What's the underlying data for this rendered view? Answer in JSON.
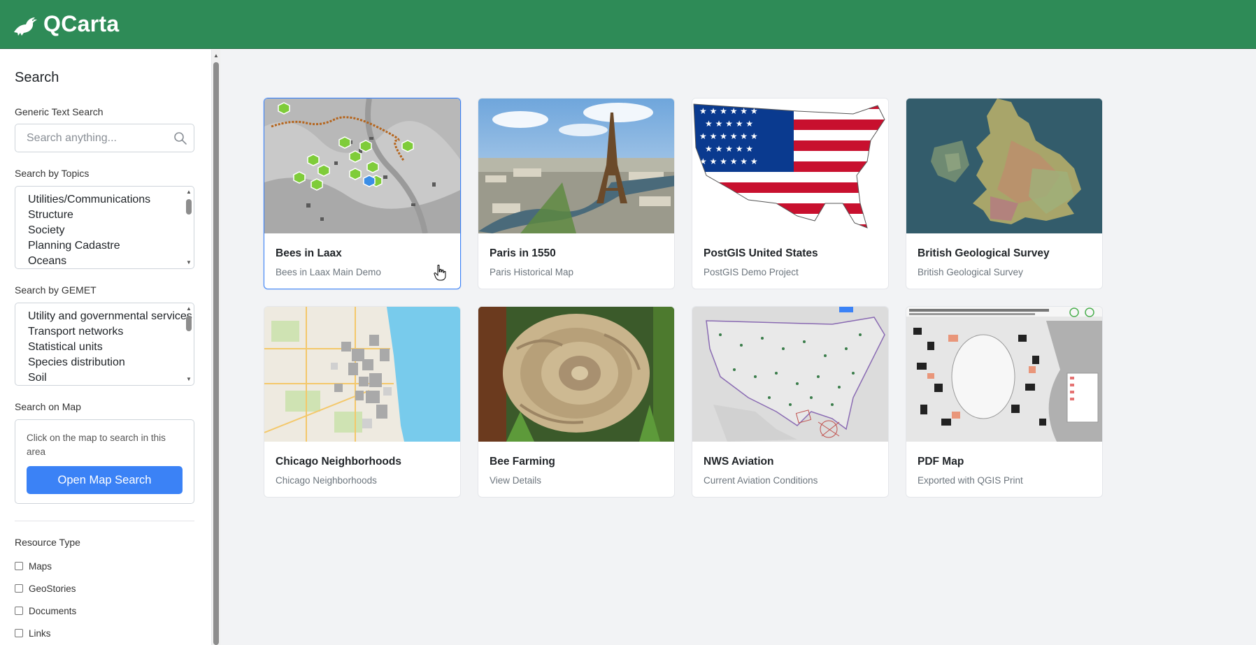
{
  "app": {
    "name": "QCarta",
    "logo_icon": "bird-logo-icon"
  },
  "sidebar": {
    "title": "Search",
    "generic_search": {
      "label": "Generic Text Search",
      "placeholder": "Search anything...",
      "icon": "search-icon"
    },
    "topics": {
      "label": "Search by Topics",
      "options": [
        "Utilities/Communications",
        "Structure",
        "Society",
        "Planning Cadastre",
        "Oceans"
      ]
    },
    "gemet": {
      "label": "Search by GEMET",
      "options": [
        "Utility and governmental services",
        "Transport networks",
        "Statistical units",
        "Species distribution",
        "Soil"
      ]
    },
    "map_search": {
      "label": "Search on Map",
      "description": "Click on the map to search in this area",
      "button": "Open Map Search"
    },
    "resource_type": {
      "label": "Resource Type",
      "options": [
        "Maps",
        "GeoStories",
        "Documents",
        "Links"
      ]
    }
  },
  "cards": [
    {
      "title": "Bees in Laax",
      "subtitle": "Bees in Laax Main Demo",
      "thumb": "laax-map",
      "selected": true
    },
    {
      "title": "Paris in 1550",
      "subtitle": "Paris Historical Map",
      "thumb": "paris-photo"
    },
    {
      "title": "PostGIS United States",
      "subtitle": "PostGIS Demo Project",
      "thumb": "us-flag"
    },
    {
      "title": "British Geological Survey",
      "subtitle": "British Geological Survey",
      "thumb": "uk-geology"
    },
    {
      "title": "Chicago Neighborhoods",
      "subtitle": "Chicago Neighborhoods",
      "thumb": "chicago-map"
    },
    {
      "title": "Bee Farming",
      "subtitle": "View Details",
      "thumb": "bee-comb-photo"
    },
    {
      "title": "NWS Aviation",
      "subtitle": "Current Aviation Conditions",
      "thumb": "aviation-map"
    },
    {
      "title": "PDF Map",
      "subtitle": "Exported with QGIS Print",
      "thumb": "pdf-map"
    }
  ],
  "colors": {
    "header": "#2e8b57",
    "primary_button": "#3b82f6",
    "selected_border": "#3b82f6"
  }
}
